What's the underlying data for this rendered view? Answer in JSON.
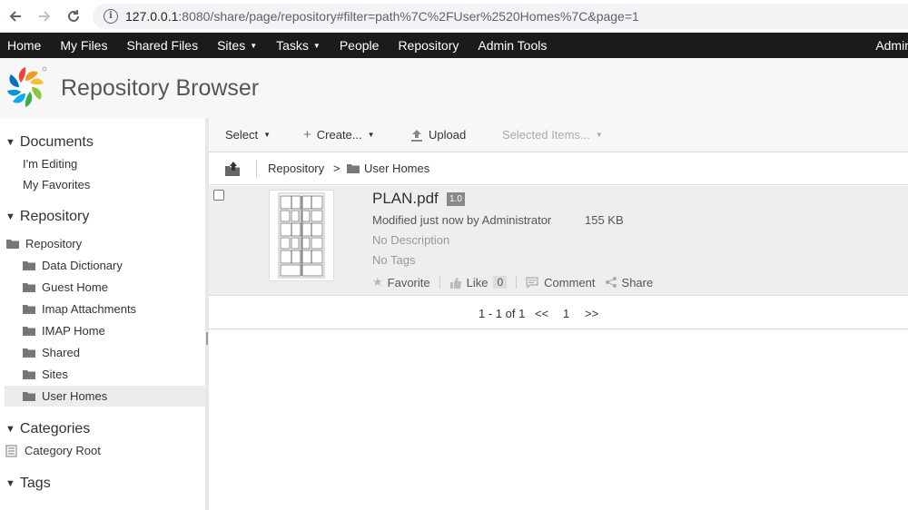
{
  "browser": {
    "url": "127.0.0.1:8080/share/page/repository#filter=path%7C%2FUser%2520Homes%7C&page=1",
    "url_host": "127.0.0.1",
    "url_rest": ":8080/share/page/repository#filter=path%7C%2FUser%2520Homes%7C&page=1"
  },
  "topmenu": {
    "items": [
      {
        "label": "Home"
      },
      {
        "label": "My Files"
      },
      {
        "label": "Shared Files"
      },
      {
        "label": "Sites",
        "dropdown": true
      },
      {
        "label": "Tasks",
        "dropdown": true
      },
      {
        "label": "People"
      },
      {
        "label": "Repository"
      },
      {
        "label": "Admin Tools"
      }
    ],
    "user": "Admin"
  },
  "header": {
    "title": "Repository Browser"
  },
  "sidebar": {
    "documents": {
      "heading": "Documents",
      "links": [
        "I'm Editing",
        "My Favorites"
      ]
    },
    "repository": {
      "heading": "Repository",
      "root": "Repository",
      "children": [
        "Data Dictionary",
        "Guest Home",
        "Imap Attachments",
        "IMAP Home",
        "Shared",
        "Sites",
        "User Homes"
      ],
      "selected": "User Homes"
    },
    "categories": {
      "heading": "Categories",
      "root": "Category Root"
    },
    "tags": {
      "heading": "Tags"
    }
  },
  "toolbar": {
    "select": "Select",
    "create": "Create...",
    "upload": "Upload",
    "selected_items": "Selected Items..."
  },
  "breadcrumb": {
    "items": [
      "Repository",
      "User Homes"
    ],
    "separator": ">"
  },
  "documents": [
    {
      "name": "PLAN.pdf",
      "version": "1.0",
      "modified": "Modified just now by Administrator",
      "size": "155 KB",
      "description": "No Description",
      "tags": "No Tags",
      "actions": {
        "favorite": "Favorite",
        "like": "Like",
        "like_count": "0",
        "comment": "Comment",
        "share": "Share"
      }
    }
  ],
  "pager": {
    "summary": "1 - 1 of 1",
    "prev": "<<",
    "page": "1",
    "next": ">>"
  },
  "colors": {
    "menu_bg": "#1b1b1b",
    "header_bg": "#f7f7f7",
    "row_bg": "#eeeeee",
    "selected_bg": "#ececec"
  }
}
